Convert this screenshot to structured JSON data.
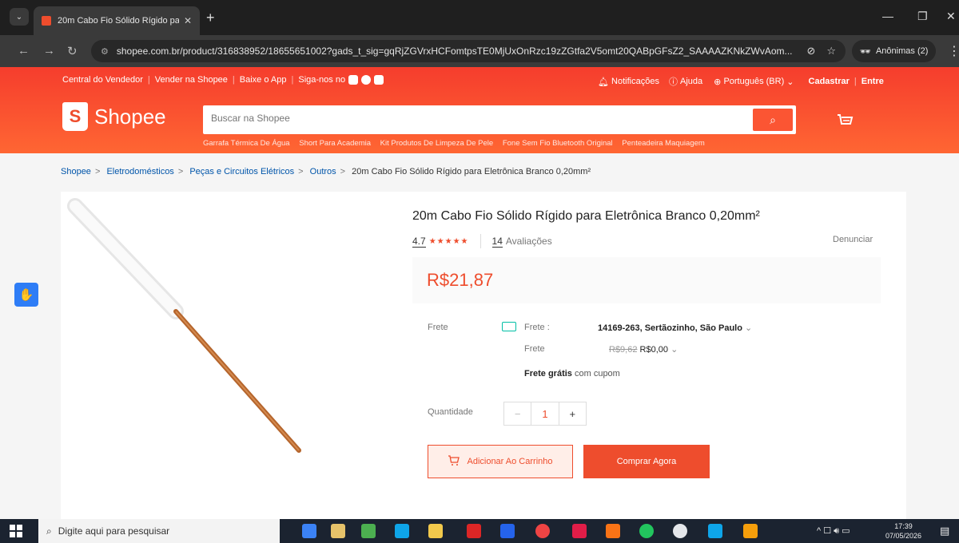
{
  "browser": {
    "tab_title": "20m Cabo Fio Sólido Rígido pa",
    "tab_close": "✕",
    "new_tab": "+",
    "url": "shopee.com.br/product/316838952/18655651002?gads_t_sig=gqRjZGVrxHCFomtpsTE0MjUxOnRzc19zZGtfa2V5omt20QABpGFsZ2_SAAAAZKNkZWvAom...",
    "incognito_label": "Anônimas (2)",
    "minimize": "—",
    "restore": "❐",
    "close": "✕"
  },
  "header": {
    "topnav_left": [
      "Central do Vendedor",
      "Vender na Shopee",
      "Baixe o App",
      "Siga-nos no"
    ],
    "notifications": "Notificações",
    "help": "Ajuda",
    "language": "Português (BR)",
    "register": "Cadastrar",
    "login": "Entre",
    "logo_text": "Shopee",
    "logo_mark": "S",
    "search_placeholder": "Buscar na Shopee",
    "suggestions": [
      "Garrafa Térmica De Água",
      "Short Para Academia",
      "Kit Produtos De Limpeza De Pele",
      "Fone Sem Fio Bluetooth Original",
      "Penteadeira Maquiagem"
    ]
  },
  "breadcrumb": [
    "Shopee",
    "Eletrodomésticos",
    "Peças e Circuitos Elétricos",
    "Outros",
    "20m Cabo Fio Sólido Rígido para Eletrônica Branco 0,20mm²"
  ],
  "product": {
    "title": "20m Cabo Fio Sólido Rígido para Eletrônica Branco 0,20mm²",
    "rating": "4.7",
    "stars": "★★★★★",
    "reviews_count": "14",
    "reviews_label": "Avaliações",
    "report": "Denunciar",
    "price": "R$21,87",
    "shipping_label": "Frete",
    "shipping_to_label": "Frete :",
    "shipping_to": "14169-263, Sertãozinho, São Paulo",
    "shipping_cost_label": "Frete",
    "shipping_old": "R$9,62",
    "shipping_new": "R$0,00",
    "free_shipping_bold": "Frete grátis",
    "free_shipping_rest": "com cupom",
    "quantity_label": "Quantidade",
    "quantity": "1",
    "add_to_cart": "Adicionar Ao Carrinho",
    "buy_now": "Comprar Agora"
  },
  "taskbar": {
    "search_placeholder": "Digite aqui para pesquisar",
    "time": "17:39",
    "date": "07/05/2026"
  },
  "colors": {
    "brand": "#ee4d2d",
    "teal": "#00bfa5"
  }
}
